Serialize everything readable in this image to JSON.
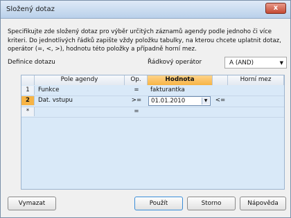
{
  "window": {
    "title": "Složený dotaz",
    "close_label": "x"
  },
  "description": "Specifikujte zde složený dotaz pro výběr určitých záznamů agendy podle jednoho či více kriteri. Do jednotlivých řádků zapište vždy položku tabulky, na kterou chcete uplatnit dotaz, operátor (=, <, >), hodnotu této položky a případně horní mez.",
  "definition_label": "Definice dotazu",
  "operator_label": "Řádkový operátor",
  "operator_select": {
    "value": "A (AND)"
  },
  "grid": {
    "headers": [
      "Pole agendy",
      "Op.",
      "Hodnota",
      "Horní mez"
    ],
    "rows": [
      {
        "num": "1",
        "field": "Funkce",
        "op": "=",
        "value": "fakturantka",
        "op2": "",
        "upper": ""
      },
      {
        "num": "2",
        "field": "Dat. vstupu",
        "op": ">=",
        "value": "01.01.2010",
        "op2": "<=",
        "upper": ""
      },
      {
        "num": "*",
        "field": "",
        "op": "=",
        "value": "",
        "op2": "",
        "upper": ""
      }
    ]
  },
  "buttons": {
    "clear": "Vymazat",
    "apply": "Použít",
    "cancel": "Storno",
    "help": "Nápověda"
  }
}
